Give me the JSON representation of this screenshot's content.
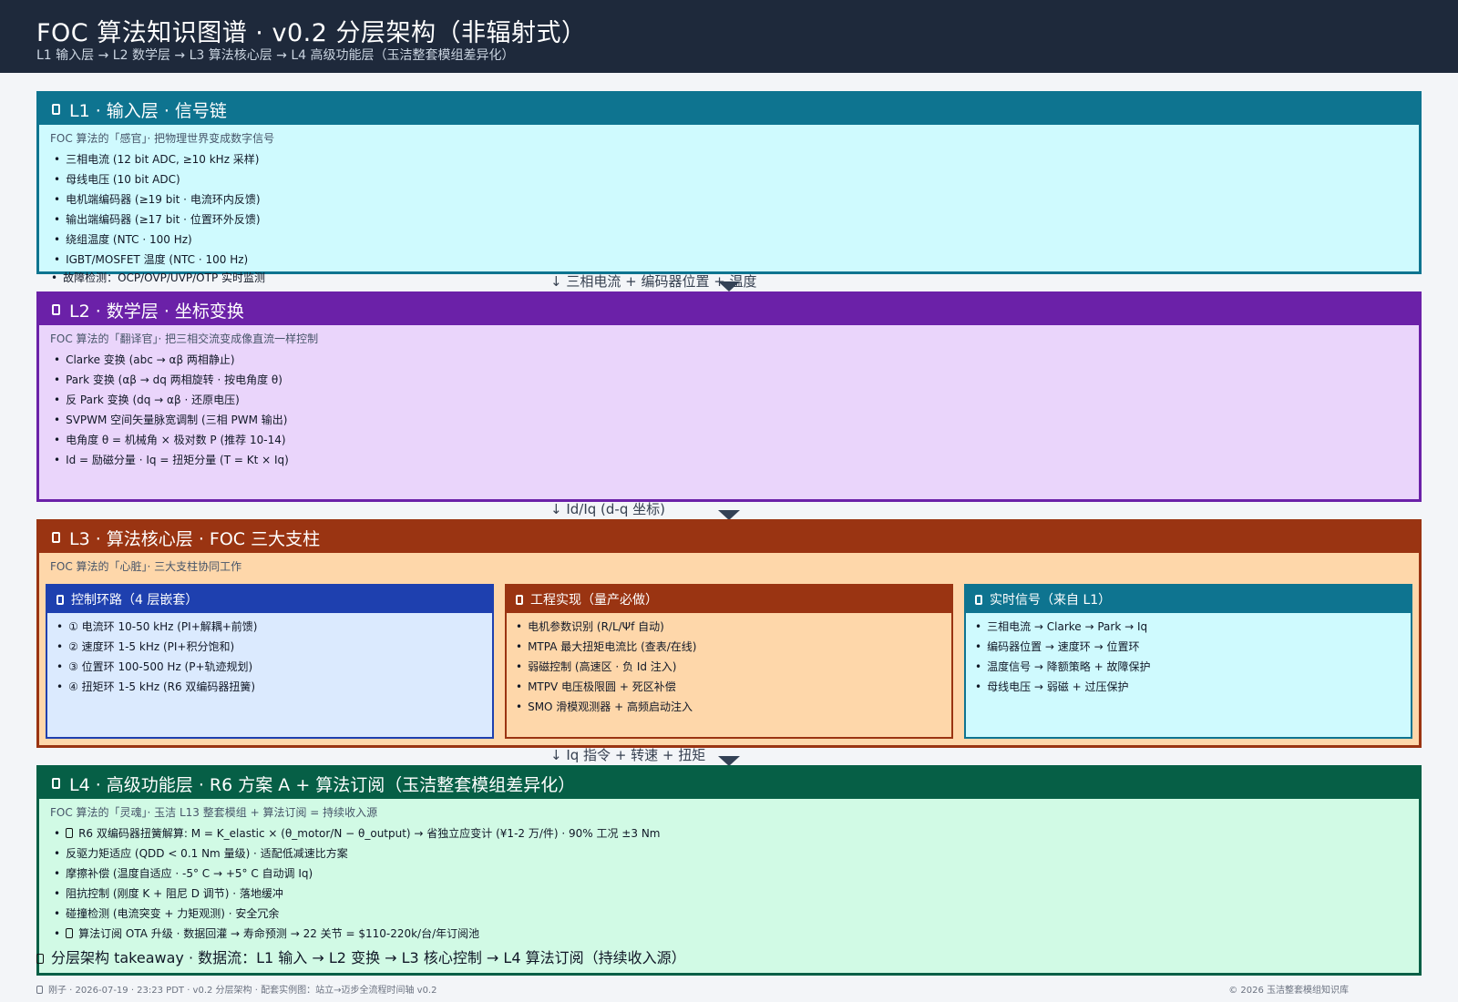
{
  "header": {
    "title": "FOC 算法知识图谱 · v0.2 分层架构（非辐射式）",
    "subtitle": "L1 输入层 → L2 数学层 → L3 算法核心层 → L4 高级功能层（玉洁整套模组差异化）"
  },
  "l1": {
    "title": "L1 · 输入层 · 信号链",
    "desc": "FOC 算法的「感官」· 把物理世界变成数字信号",
    "items": [
      "三相电流 (12 bit ADC, ≥10 kHz 采样)",
      "母线电压 (10 bit ADC)",
      "电机端编码器 (≥19 bit · 电流环内反馈)",
      "输出端编码器 (≥17 bit · 位置环外反馈)",
      "绕组温度 (NTC · 100 Hz)",
      "IGBT/MOSFET 温度 (NTC · 100 Hz)",
      "故障检测：OCP/OVP/UVP/OTP 实时监测"
    ]
  },
  "flow1": "↓ 三相电流 + 编码器位置 + 温度",
  "l2": {
    "title": "L2 · 数学层 · 坐标变换",
    "desc": "FOC 算法的「翻译官」· 把三相交流变成像直流一样控制",
    "items": [
      "Clarke 变换 (abc → αβ 两相静止)",
      "Park 变换 (αβ → dq 两相旋转 · 按电角度 θ)",
      "反 Park 变换 (dq → αβ · 还原电压)",
      "SVPWM 空间矢量脉宽调制 (三相 PWM 输出)",
      "电角度 θ = 机械角 × 极对数 P (推荐 10-14)",
      "Id = 励磁分量 · Iq = 扭矩分量 (T = Kt × Iq)"
    ]
  },
  "flow2": "↓ Id/Iq (d-q 坐标)",
  "l3": {
    "title": "L3 · 算法核心层 · FOC 三大支柱",
    "desc": "FOC 算法的「心脏」· 三大支柱协同工作",
    "col1": {
      "title": "控制环路（4 层嵌套）",
      "items": [
        "① 电流环 10-50 kHz (PI+解耦+前馈)",
        "② 速度环 1-5 kHz (PI+积分饱和)",
        "③ 位置环 100-500 Hz (P+轨迹规划)",
        "④ 扭矩环 1-5 kHz (R6 双编码器扭簧)"
      ]
    },
    "col2": {
      "title": "工程实现（量产必做）",
      "items": [
        "电机参数识别 (R/L/Ψf 自动)",
        "MTPA 最大扭矩电流比 (查表/在线)",
        "弱磁控制 (高速区 · 负 Id 注入)",
        "MTPV 电压极限圆 + 死区补偿",
        "SMO 滑模观测器 + 高频启动注入"
      ]
    },
    "col3": {
      "title": "实时信号（来自 L1）",
      "items": [
        "三相电流 → Clarke → Park → Iq",
        "编码器位置 → 速度环 → 位置环",
        "温度信号 → 降额策略 + 故障保护",
        "母线电压 → 弱磁 + 过压保护"
      ]
    }
  },
  "flow3": "↓ Iq 指令 + 转速 + 扭矩",
  "l4": {
    "title": "L4 · 高级功能层 · R6 方案 A + 算法订阅（玉洁整套模组差异化）",
    "desc": "FOC 算法的「灵魂」· 玉洁 L13 整套模组 + 算法订阅 = 持续收入源",
    "items": [
      "R6 双编码器扭簧解算: M = K_elastic × (θ_motor/N − θ_output) → 省独立应变计 (¥1-2 万/件) · 90% 工况 ±3 Nm",
      "反驱力矩适应 (QDD < 0.1 Nm 量级) · 适配低减速比方案",
      "摩擦补偿 (温度自适应 · -5° C → +5° C 自动调 Iq)",
      "阻抗控制 (刚度 K + 阻尼 D 调节) · 落地缓冲",
      "碰撞检测 (电流突变 + 力矩观测) · 安全冗余",
      "算法订阅 OTA 升级 · 数据回灌 → 寿命预测 → 22 关节 = $110-220k/台/年订阅池"
    ]
  },
  "takeaway": "分层架构 takeaway · 数据流：L1 输入 → L2 变换 → L3 核心控制 → L4 算法订阅（持续收入源）",
  "footer": {
    "left": "刚子 · 2026-07-19 · 23:23 PDT · v0.2 分层架构 · 配套实例图：站立→迈步全流程时间轴 v0.2",
    "right": "© 2026 玉洁整套模组知识库"
  }
}
